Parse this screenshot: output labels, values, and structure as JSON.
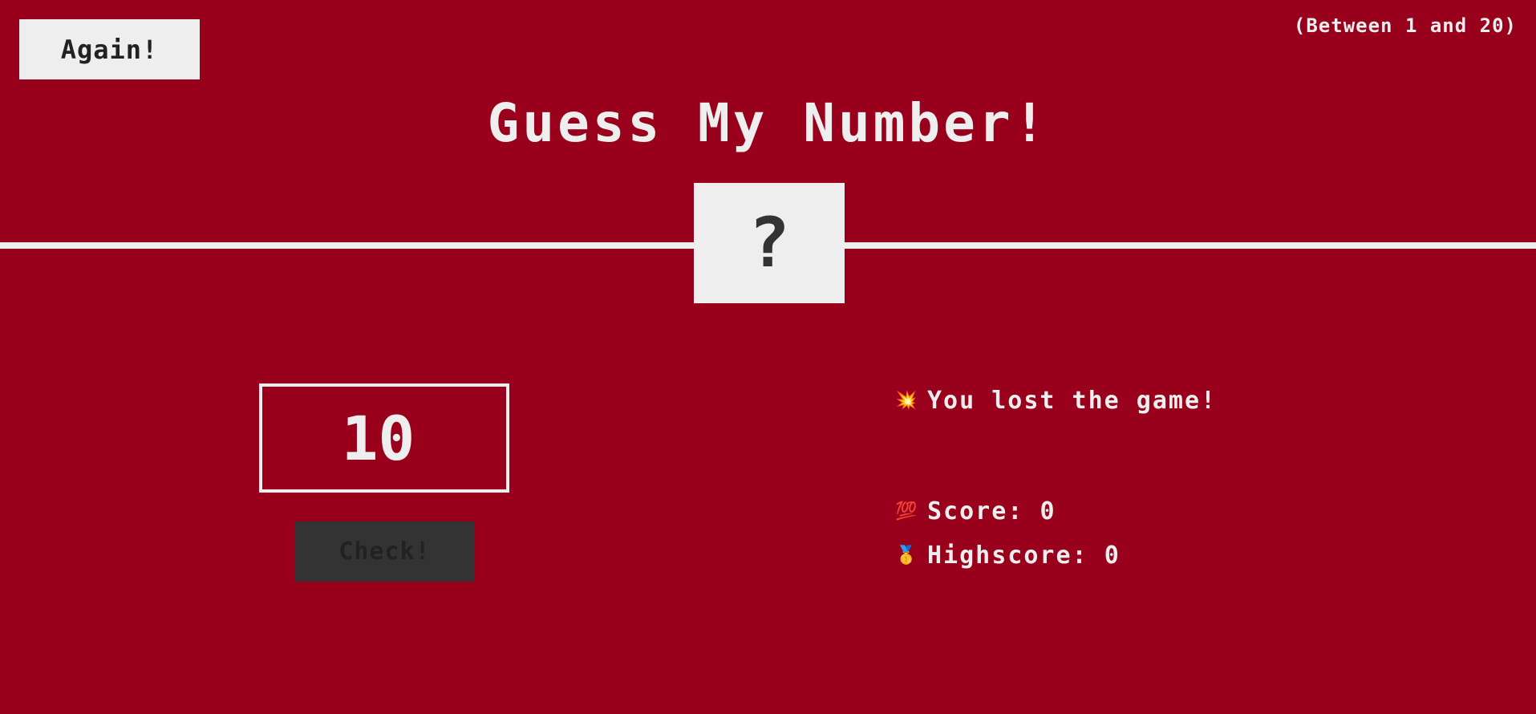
{
  "header": {
    "again_label": "Again!",
    "range_text": "(Between 1 and 20)",
    "title": "Guess My Number!",
    "secret": "?"
  },
  "left": {
    "guess_value": "10",
    "check_label": "Check!"
  },
  "right": {
    "message_icon": "💥",
    "message": "You lost the game!",
    "score_icon": "💯",
    "score_label": "Score:",
    "score_value": "0",
    "highscore_icon": "🥇",
    "highscore_label": "Highscore:",
    "highscore_value": "0"
  },
  "colors": {
    "background": "#98001c",
    "foreground": "#eeeeee",
    "dark": "#333333"
  }
}
